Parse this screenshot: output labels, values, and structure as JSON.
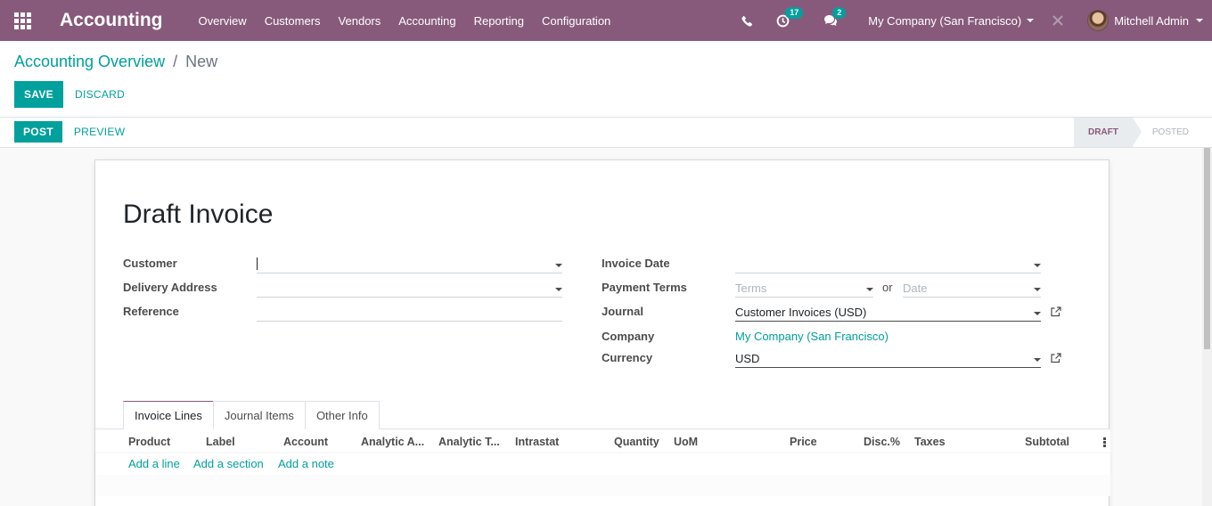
{
  "navbar": {
    "brand": "Accounting",
    "menu": [
      "Overview",
      "Customers",
      "Vendors",
      "Accounting",
      "Reporting",
      "Configuration"
    ],
    "activities_count": "17",
    "messages_count": "2",
    "company": "My Company (San Francisco)",
    "user": "Mitchell Admin"
  },
  "breadcrumb": {
    "parent": "Accounting Overview",
    "separator": "/",
    "current": "New"
  },
  "buttons": {
    "save": "SAVE",
    "discard": "DISCARD",
    "post": "POST",
    "preview": "PREVIEW"
  },
  "status": {
    "stages": [
      "DRAFT",
      "POSTED"
    ],
    "active": "DRAFT"
  },
  "form": {
    "title": "Draft Invoice",
    "left": {
      "customer_label": "Customer",
      "customer_value": "",
      "delivery_label": "Delivery Address",
      "delivery_value": "",
      "reference_label": "Reference",
      "reference_value": ""
    },
    "right": {
      "invoice_date_label": "Invoice Date",
      "invoice_date_value": "",
      "payment_terms_label": "Payment Terms",
      "terms_placeholder": "Terms",
      "or": "or",
      "date_placeholder": "Date",
      "journal_label": "Journal",
      "journal_value": "Customer Invoices (USD)",
      "company_label": "Company",
      "company_value": "My Company (San Francisco)",
      "currency_label": "Currency",
      "currency_value": "USD"
    }
  },
  "tabs": [
    "Invoice Lines",
    "Journal Items",
    "Other Info"
  ],
  "active_tab": "Invoice Lines",
  "table": {
    "columns": [
      "Product",
      "Label",
      "Account",
      "Analytic A...",
      "Analytic T...",
      "Intrastat",
      "Quantity",
      "UoM",
      "Price",
      "Disc.%",
      "Taxes",
      "Subtotal"
    ],
    "actions": [
      "Add a line",
      "Add a section",
      "Add a note"
    ]
  },
  "colors": {
    "brand": "#875a7b",
    "accent": "#00a09d"
  }
}
